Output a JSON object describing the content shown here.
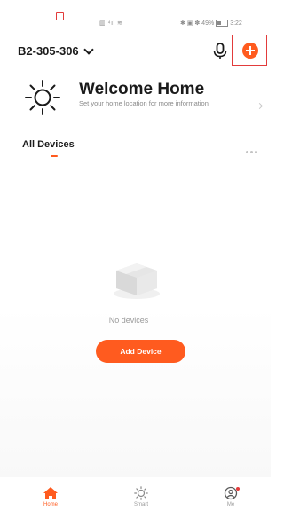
{
  "status_bar": {
    "signal_text": "▥ ⁴ıl ≋",
    "right_text": "✱ ▣ ✽ 49%",
    "time": "3:22"
  },
  "header": {
    "home_name": "B2-305-306"
  },
  "welcome": {
    "title": "Welcome Home",
    "subtitle": "Set your home location for more information"
  },
  "tabs": {
    "all_devices": "All Devices"
  },
  "empty_state": {
    "message": "No devices",
    "add_device_label": "Add Device"
  },
  "bottom_nav": {
    "items": [
      {
        "label": "Home",
        "icon": "home-icon",
        "active": true
      },
      {
        "label": "Smart",
        "icon": "scene-sun-icon",
        "active": false
      },
      {
        "label": "Me",
        "icon": "profile-icon",
        "active": false
      }
    ]
  },
  "colors": {
    "accent": "#ff5b1f",
    "highlight_box": "#e23b3b",
    "text_primary": "#1a1a1a",
    "text_secondary": "#9a9a9a"
  }
}
